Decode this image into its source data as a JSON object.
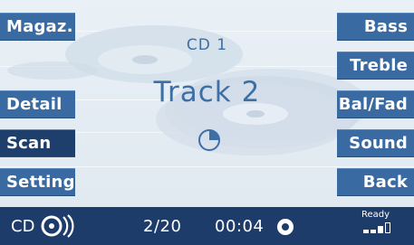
{
  "left_buttons": [
    {
      "label": "Magaz.",
      "active": false
    },
    {
      "label": "Detail",
      "active": false
    },
    {
      "label": "Scan",
      "active": true
    },
    {
      "label": "Setting",
      "active": false
    }
  ],
  "right_buttons": [
    {
      "label": "Bass"
    },
    {
      "label": "Treble"
    },
    {
      "label": "Bal/Fad"
    },
    {
      "label": "Sound"
    },
    {
      "label": "Back"
    }
  ],
  "main": {
    "disc": "CD 1",
    "track": "Track 2"
  },
  "status": {
    "source": "CD",
    "track_count": "2/20",
    "time": "00:04",
    "ready": "Ready"
  },
  "icons": {
    "source": "cd-disc-icon",
    "progress": "clock-progress-icon",
    "play": "play-dot-icon",
    "signal": "signal-strength-icon"
  },
  "colors": {
    "button": "#3a6aa2",
    "active_button": "#1e3f6b",
    "statusbar": "#1d3c6a",
    "accent_text": "#3d6fa6"
  }
}
